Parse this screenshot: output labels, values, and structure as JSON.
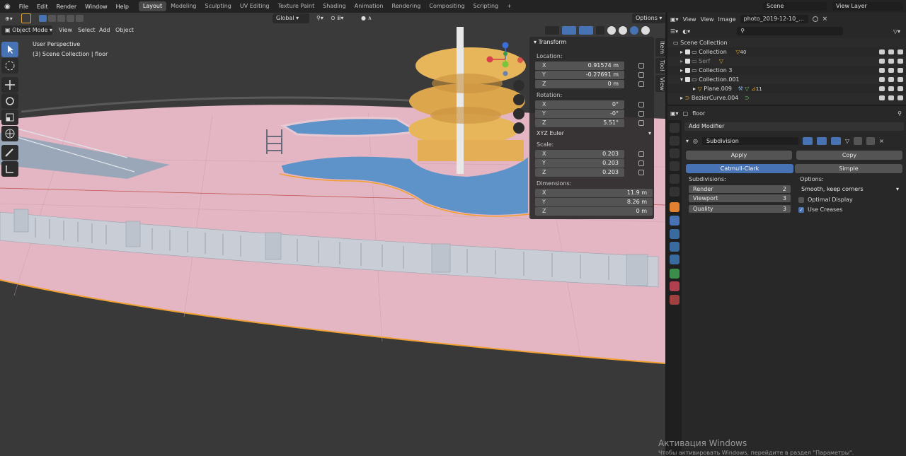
{
  "topbar": {
    "menus": [
      "File",
      "Edit",
      "Render",
      "Window",
      "Help"
    ],
    "workspaces": [
      "Layout",
      "Modeling",
      "Sculpting",
      "UV Editing",
      "Texture Paint",
      "Shading",
      "Animation",
      "Rendering",
      "Compositing",
      "Scripting"
    ],
    "active_workspace": "Layout",
    "add_tab": "+",
    "scene": "Scene",
    "view_layer": "View Layer"
  },
  "viewport": {
    "mode": "Object Mode",
    "menus": [
      "View",
      "Select",
      "Add",
      "Object"
    ],
    "orientation": "Global",
    "options": "Options",
    "overlay_title": "User Perspective",
    "overlay_subtitle": "(3) Scene Collection | floor"
  },
  "npanel": {
    "title": "Transform",
    "location_label": "Location:",
    "location": [
      {
        "axis": "X",
        "value": "0.91574 m"
      },
      {
        "axis": "Y",
        "value": "-0.27691 m"
      },
      {
        "axis": "Z",
        "value": "0 m"
      }
    ],
    "rotation_label": "Rotation:",
    "rotation": [
      {
        "axis": "X",
        "value": "0°"
      },
      {
        "axis": "Y",
        "value": "-0°"
      },
      {
        "axis": "Z",
        "value": "5.51°"
      }
    ],
    "rotation_mode": "XYZ Euler",
    "scale_label": "Scale:",
    "scale": [
      {
        "axis": "X",
        "value": "0.203"
      },
      {
        "axis": "Y",
        "value": "0.203"
      },
      {
        "axis": "Z",
        "value": "0.203"
      }
    ],
    "dimensions_label": "Dimensions:",
    "dimensions": [
      {
        "axis": "X",
        "value": "11.9 m"
      },
      {
        "axis": "Y",
        "value": "8.26 m"
      },
      {
        "axis": "Z",
        "value": "0 m"
      }
    ],
    "side_tabs": [
      "Item",
      "Tool",
      "View"
    ]
  },
  "outliner": {
    "header_view": "View",
    "header_view2": "View",
    "header_image": "Image",
    "image_name": "photo_2019-12-10_...",
    "root": "Scene Collection",
    "items": [
      {
        "name": "Collection",
        "indent": 1,
        "badge": "40"
      },
      {
        "name": "Serf",
        "indent": 1,
        "badge": ""
      },
      {
        "name": "Collection 3",
        "indent": 1,
        "badge": ""
      },
      {
        "name": "Collection.001",
        "indent": 1,
        "badge": ""
      },
      {
        "name": "Plane.009",
        "indent": 2,
        "badge": "11"
      },
      {
        "name": "BezierCurve.004",
        "indent": 1,
        "badge": ""
      }
    ]
  },
  "properties": {
    "object_name": "floor",
    "add_modifier": "Add Modifier",
    "modifier_name": "Subdivision",
    "apply": "Apply",
    "copy": "Copy",
    "mode_catmull": "Catmull-Clark",
    "mode_simple": "Simple",
    "subdivisions_label": "Subdivisions:",
    "render_label": "Render",
    "render_value": "2",
    "viewport_label": "Viewport",
    "viewport_value": "3",
    "quality_label": "Quality",
    "quality_value": "3",
    "options_label": "Options:",
    "options_value": "Smooth, keep corners",
    "optimal_display": "Optimal Display",
    "use_creases": "Use Creases"
  },
  "watermark": {
    "title": "Активация Windows",
    "subtitle": "Чтобы активировать Windows, перейдите в раздел \"Параметры\"."
  },
  "colors": {
    "accent": "#4772b3",
    "floor": "#e4b6c3",
    "slide": "#e7b55a",
    "water": "#5d93c9",
    "selection": "#f0a030"
  }
}
